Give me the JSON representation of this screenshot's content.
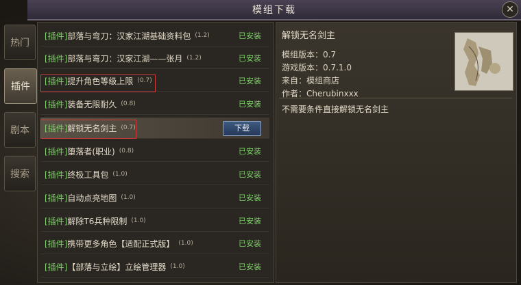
{
  "window": {
    "title": "模组下载",
    "close_glyph": "✕"
  },
  "side_tabs": [
    {
      "label": "热门",
      "active": false
    },
    {
      "label": "插件",
      "active": true
    },
    {
      "label": "剧本",
      "active": false
    },
    {
      "label": "搜索",
      "active": false
    }
  ],
  "list": [
    {
      "tag": "[插件]",
      "name": "部落与弯刀：汉家江湖基础资料包",
      "ver": "(1.2)",
      "status": "已安装"
    },
    {
      "tag": "[插件]",
      "name": "部落与弯刀：汉家江湖——张月",
      "ver": "(1.2)",
      "status": "已安装"
    },
    {
      "tag": "[插件]",
      "name": "提升角色等级上限",
      "ver": "(0.7)",
      "status": "已安装"
    },
    {
      "tag": "[插件]",
      "name": "装备无限耐久",
      "ver": "(0.8)",
      "status": "已安装"
    },
    {
      "tag": "[插件]",
      "name": "解锁无名剑主",
      "ver": "(0.7)",
      "button": "下载"
    },
    {
      "tag": "[插件]",
      "name": "堕落者(职业)",
      "ver": "(0.8)",
      "status": "已安装"
    },
    {
      "tag": "[插件]",
      "name": "终极工具包",
      "ver": "(1.0)",
      "status": "已安装"
    },
    {
      "tag": "[插件]",
      "name": "自动点亮地图",
      "ver": "(1.0)",
      "status": "已安装"
    },
    {
      "tag": "[插件]",
      "name": "解除T6兵种限制",
      "ver": "(1.0)",
      "status": "已安装"
    },
    {
      "tag": "[插件]",
      "name": "携带更多角色【适配正式版】",
      "ver": "(1.0)",
      "status": "已安装"
    },
    {
      "tag": "[插件]",
      "name": "【部落与立绘】立绘管理器",
      "ver": "(1.0)",
      "status": "已安装"
    }
  ],
  "detail": {
    "title": "解锁无名剑主",
    "mod_version": "模组版本：0.7",
    "game_version": "游戏版本：0.7.1.0",
    "source": "来自：模组商店",
    "author": "作者：Cherubinxxx",
    "description": "不需要条件直接解锁无名剑主"
  },
  "colors": {
    "installed": "#7ed46a",
    "highlight": "#d43c3c",
    "button": "#3e5a80"
  }
}
